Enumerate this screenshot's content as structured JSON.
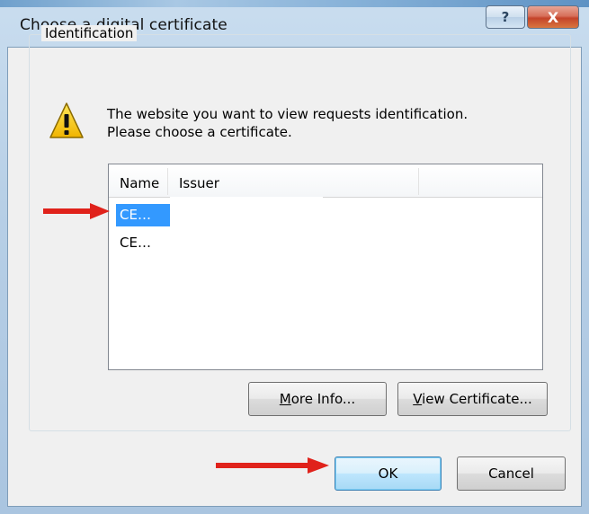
{
  "window": {
    "title": "Choose a digital certificate",
    "help_glyph": "?",
    "close_glyph": "X"
  },
  "group": {
    "label": "Identification"
  },
  "message": {
    "line1": "The website you want to view requests identification.",
    "line2": "Please choose a certificate."
  },
  "list": {
    "columns": [
      "Name",
      "Issuer"
    ],
    "rows": [
      {
        "name": "CE…",
        "selected": true
      },
      {
        "name": "CE…",
        "selected": false
      }
    ]
  },
  "buttons": {
    "more_info": {
      "mnemonic": "M",
      "rest": "ore Info..."
    },
    "view_certificate": {
      "mnemonic": "V",
      "rest": "iew Certificate..."
    },
    "ok": "OK",
    "cancel": "Cancel"
  },
  "colors": {
    "selection": "#3399ff",
    "arrow": "#e0221b",
    "warning": "#f5c400"
  },
  "icons": [
    "warning-icon",
    "help-icon",
    "close-icon",
    "red-arrow-annotation"
  ]
}
